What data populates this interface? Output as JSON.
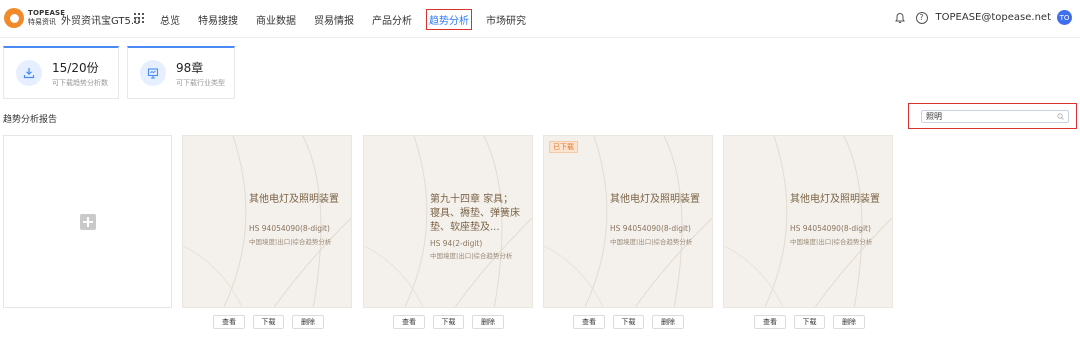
{
  "brand": {
    "en": "TOPEASE",
    "zh": "特易资讯",
    "app_name": "外贸资讯宝GT5.0"
  },
  "nav": {
    "items": [
      {
        "label": "总览",
        "active": false
      },
      {
        "label": "特易搜搜",
        "active": false
      },
      {
        "label": "商业数据",
        "active": false
      },
      {
        "label": "贸易情报",
        "active": false
      },
      {
        "label": "产品分析",
        "active": false
      },
      {
        "label": "趋势分析",
        "active": true
      },
      {
        "label": "市场研究",
        "active": false
      }
    ]
  },
  "user": {
    "email": "TOPEASE@topease.net",
    "avatar_initials": "TO"
  },
  "stats": [
    {
      "value": "15/20份",
      "label": "可下载趋势分析数",
      "icon": "download-icon"
    },
    {
      "value": "98章",
      "label": "可下载行业类型",
      "icon": "monitor-icon"
    }
  ],
  "section": {
    "title": "趋势分析报告"
  },
  "search": {
    "value": "照明"
  },
  "cards": [
    {
      "title": "其他电灯及照明装置",
      "code": "HS 94054090(8-digit)",
      "desc": "中国境度|出口|综合趋势分析",
      "downloaded": false
    },
    {
      "title": "第九十四章 家具；寝具、褥垫、弹簧床垫、软座垫及...",
      "code": "HS 94(2-digit)",
      "desc": "中国境度|出口|综合趋势分析",
      "downloaded": false
    },
    {
      "title": "其他电灯及照明装置",
      "code": "HS 94054090(8-digit)",
      "desc": "中国境度|出口|综合趋势分析",
      "downloaded": true
    },
    {
      "title": "其他电灯及照明装置",
      "code": "HS 94054090(8-digit)",
      "desc": "中国境度|出口|综合趋势分析",
      "downloaded": false
    }
  ],
  "downloaded_tag": "已下载",
  "buttons": {
    "view": "查看",
    "download": "下载",
    "delete": "删除"
  },
  "colors": {
    "accent": "#2f7cf6",
    "highlight": "#d9322c",
    "card_bg": "#f4f1ec"
  }
}
